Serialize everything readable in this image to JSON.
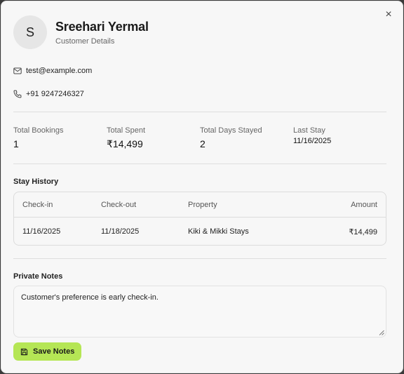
{
  "customer": {
    "initial": "S",
    "name": "Sreehari Yermal",
    "subtitle": "Customer Details",
    "email": "test@example.com",
    "phone": "+91 9247246327"
  },
  "stats": [
    {
      "label": "Total Bookings",
      "value": "1"
    },
    {
      "label": "Total Spent",
      "value": "₹14,499"
    },
    {
      "label": "Total Days Stayed",
      "value": "2"
    },
    {
      "label": "Last Stay",
      "value": "11/16/2025"
    }
  ],
  "stay_history": {
    "title": "Stay History",
    "columns": [
      "Check-in",
      "Check-out",
      "Property",
      "Amount"
    ],
    "rows": [
      [
        "11/16/2025",
        "11/18/2025",
        "Kiki & Mikki Stays",
        "₹14,499"
      ]
    ]
  },
  "notes": {
    "title": "Private Notes",
    "value": "Customer's preference is early check-in."
  },
  "actions": {
    "save_label": "Save Notes",
    "close_glyph": "×"
  },
  "colors": {
    "accent": "#b5e655",
    "background": "#f7f7f7"
  }
}
